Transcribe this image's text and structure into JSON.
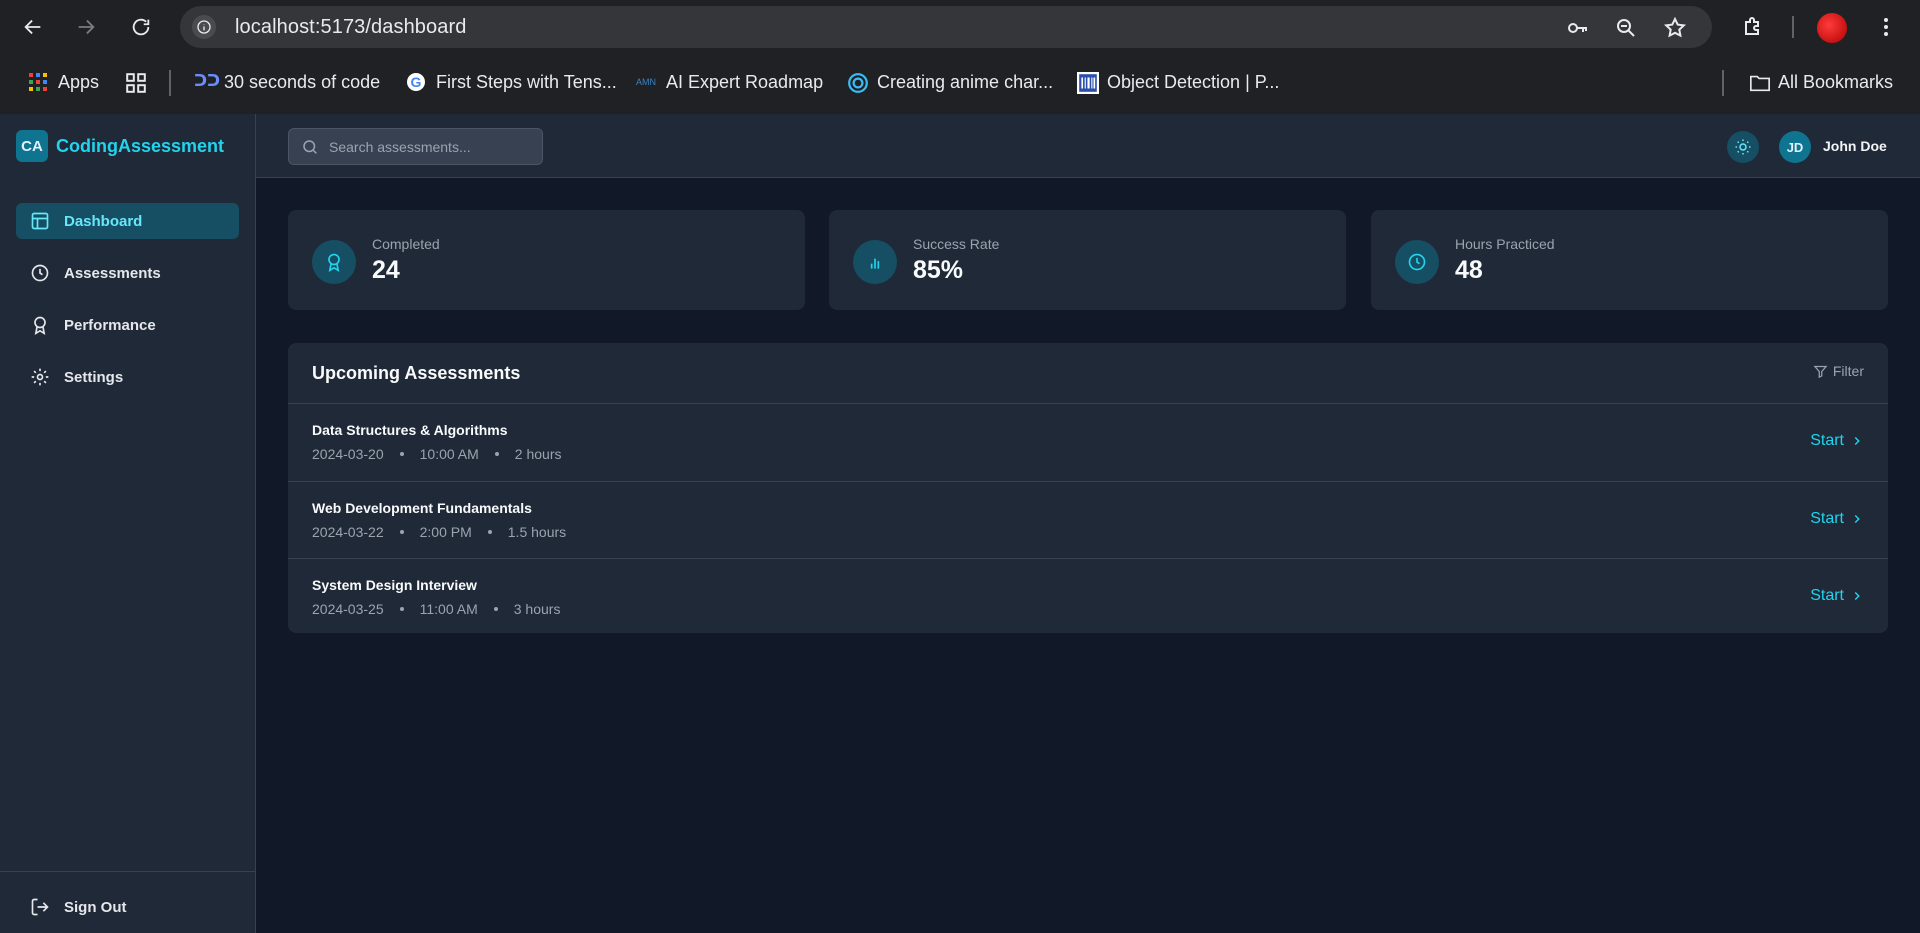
{
  "browser": {
    "url": "localhost:5173/dashboard",
    "bookmarks": [
      {
        "label": "Apps",
        "icon": "apps-grid-icon"
      },
      {
        "label": "",
        "icon": "tab-groups-icon"
      },
      {
        "label": "30 seconds of code",
        "icon": "30-seconds-icon"
      },
      {
        "label": "First Steps with Tens...",
        "icon": "google-icon"
      },
      {
        "label": "AI Expert Roadmap",
        "icon": "roadmap-icon"
      },
      {
        "label": "Creating anime char...",
        "icon": "anime-icon"
      },
      {
        "label": "Object Detection | P...",
        "icon": "barcode-icon"
      }
    ],
    "all_bookmarks": "All Bookmarks"
  },
  "brand": {
    "logo": "CA",
    "name": "CodingAssessment"
  },
  "sidebar": {
    "items": [
      {
        "label": "Dashboard",
        "icon": "layout-icon",
        "active": true
      },
      {
        "label": "Assessments",
        "icon": "clock-icon",
        "active": false
      },
      {
        "label": "Performance",
        "icon": "award-icon",
        "active": false
      },
      {
        "label": "Settings",
        "icon": "gear-icon",
        "active": false
      }
    ],
    "sign_out": "Sign Out"
  },
  "topbar": {
    "search_placeholder": "Search assessments...",
    "avatar_initials": "JD",
    "user_name": "John Doe"
  },
  "stats": [
    {
      "label": "Completed",
      "value": "24",
      "icon": "award-icon"
    },
    {
      "label": "Success Rate",
      "value": "85%",
      "icon": "bar-chart-icon"
    },
    {
      "label": "Hours Practiced",
      "value": "48",
      "icon": "clock-icon"
    }
  ],
  "upcoming": {
    "title": "Upcoming Assessments",
    "filter_label": "Filter",
    "start_label": "Start",
    "rows": [
      {
        "name": "Data Structures & Algorithms",
        "date": "2024-03-20",
        "time": "10:00 AM",
        "duration": "2 hours"
      },
      {
        "name": "Web Development Fundamentals",
        "date": "2024-03-22",
        "time": "2:00 PM",
        "duration": "1.5 hours"
      },
      {
        "name": "System Design Interview",
        "date": "2024-03-25",
        "time": "11:00 AM",
        "duration": "3 hours"
      }
    ]
  },
  "colors": {
    "accent": "#22d3ee",
    "bg": "#111827",
    "card": "#1f2937",
    "active_bg": "#164e63"
  }
}
